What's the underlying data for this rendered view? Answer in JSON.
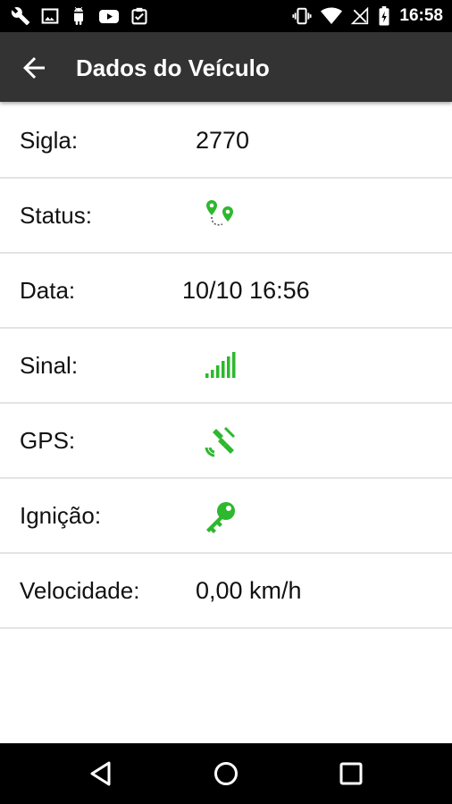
{
  "status_bar": {
    "time": "16:58",
    "left_icons": [
      "wrench-icon",
      "image-icon",
      "android-icon",
      "youtube-icon",
      "clipboard-check-icon"
    ],
    "right_icons": [
      "vibrate-icon",
      "wifi-icon",
      "no-signal-icon",
      "battery-charging-icon"
    ]
  },
  "app_bar": {
    "title": "Dados do Veículo",
    "back_icon": "arrow-back-icon"
  },
  "details": {
    "sigla": {
      "label": "Sigla:",
      "value": "2770"
    },
    "status": {
      "label": "Status:",
      "icon": "route-pins-icon"
    },
    "data": {
      "label": "Data:",
      "value": "10/10 16:56"
    },
    "sinal": {
      "label": "Sinal:",
      "icon": "signal-bars-icon"
    },
    "gps": {
      "label": "GPS:",
      "icon": "satellite-icon"
    },
    "ignicao": {
      "label": "Ignição:",
      "icon": "key-icon"
    },
    "velocidade": {
      "label": "Velocidade:",
      "value": "0,00 km/h"
    }
  },
  "colors": {
    "accent_green": "#2db82d",
    "app_bar": "#333333",
    "divider": "#e4e4e4"
  },
  "nav_bar": {
    "buttons": [
      "back-triangle-icon",
      "home-circle-icon",
      "recents-square-icon"
    ]
  }
}
